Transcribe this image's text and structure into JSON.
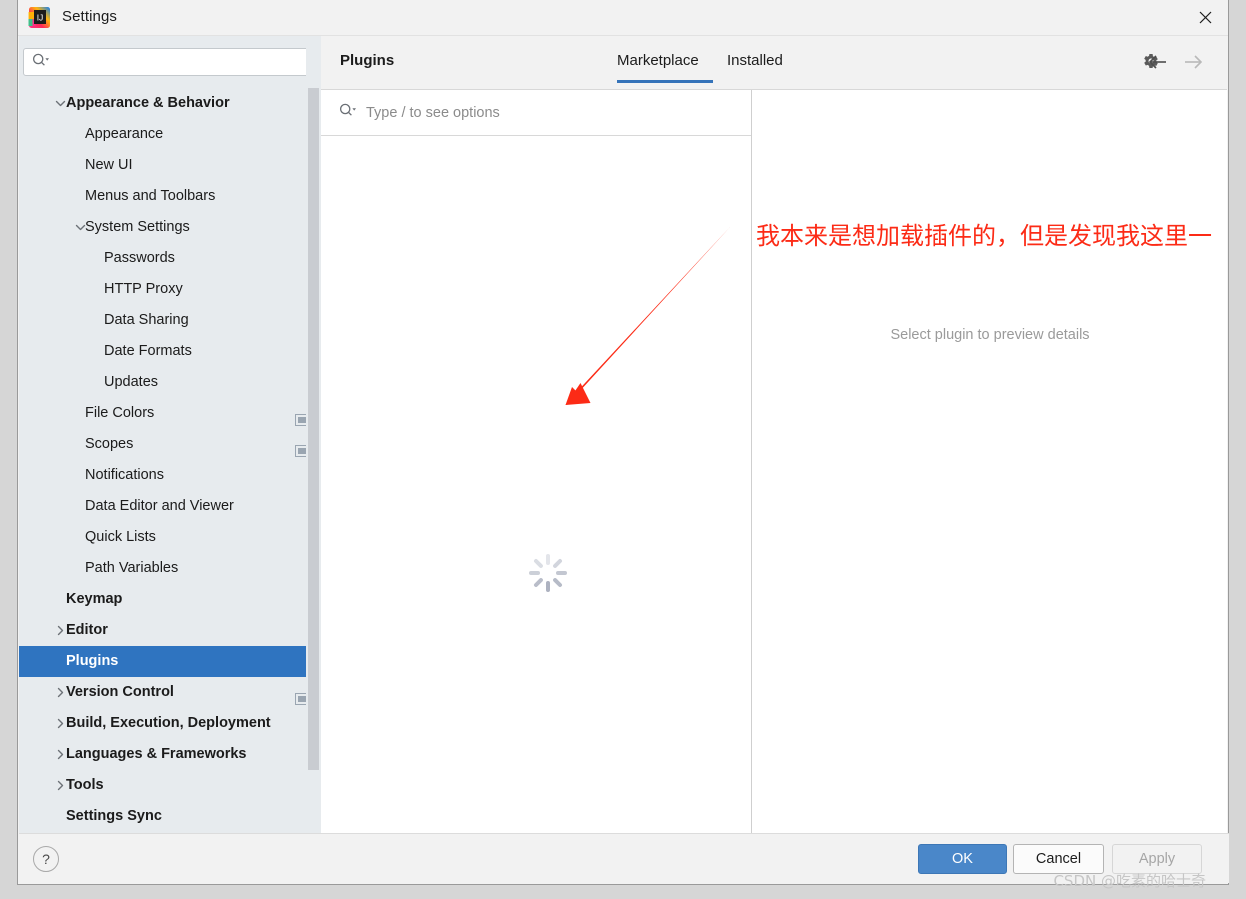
{
  "window": {
    "title": "Settings",
    "app_icon": "intellij-idea-logo",
    "close_icon": "close-icon"
  },
  "sidebar": {
    "search": {
      "placeholder": "",
      "value": "",
      "icon": "search-icon"
    },
    "items": [
      {
        "label": "Appearance & Behavior",
        "level": 0,
        "bold": true,
        "chevron": "down",
        "selected": false,
        "badge": false
      },
      {
        "label": "Appearance",
        "level": 1,
        "bold": false,
        "chevron": "none",
        "selected": false,
        "badge": false
      },
      {
        "label": "New UI",
        "level": 1,
        "bold": false,
        "chevron": "none",
        "selected": false,
        "badge": false
      },
      {
        "label": "Menus and Toolbars",
        "level": 1,
        "bold": false,
        "chevron": "none",
        "selected": false,
        "badge": false
      },
      {
        "label": "System Settings",
        "level": 1,
        "bold": false,
        "chevron": "down",
        "selected": false,
        "badge": false
      },
      {
        "label": "Passwords",
        "level": 2,
        "bold": false,
        "chevron": "none",
        "selected": false,
        "badge": false
      },
      {
        "label": "HTTP Proxy",
        "level": 2,
        "bold": false,
        "chevron": "none",
        "selected": false,
        "badge": false
      },
      {
        "label": "Data Sharing",
        "level": 2,
        "bold": false,
        "chevron": "none",
        "selected": false,
        "badge": false
      },
      {
        "label": "Date Formats",
        "level": 2,
        "bold": false,
        "chevron": "none",
        "selected": false,
        "badge": false
      },
      {
        "label": "Updates",
        "level": 2,
        "bold": false,
        "chevron": "none",
        "selected": false,
        "badge": false
      },
      {
        "label": "File Colors",
        "level": 1,
        "bold": false,
        "chevron": "none",
        "selected": false,
        "badge": true
      },
      {
        "label": "Scopes",
        "level": 1,
        "bold": false,
        "chevron": "none",
        "selected": false,
        "badge": true
      },
      {
        "label": "Notifications",
        "level": 1,
        "bold": false,
        "chevron": "none",
        "selected": false,
        "badge": false
      },
      {
        "label": "Data Editor and Viewer",
        "level": 1,
        "bold": false,
        "chevron": "none",
        "selected": false,
        "badge": false
      },
      {
        "label": "Quick Lists",
        "level": 1,
        "bold": false,
        "chevron": "none",
        "selected": false,
        "badge": false
      },
      {
        "label": "Path Variables",
        "level": 1,
        "bold": false,
        "chevron": "none",
        "selected": false,
        "badge": false
      },
      {
        "label": "Keymap",
        "level": 0,
        "bold": true,
        "chevron": "none",
        "selected": false,
        "badge": false
      },
      {
        "label": "Editor",
        "level": 0,
        "bold": true,
        "chevron": "right",
        "selected": false,
        "badge": false
      },
      {
        "label": "Plugins",
        "level": 0,
        "bold": true,
        "chevron": "none",
        "selected": true,
        "badge": false
      },
      {
        "label": "Version Control",
        "level": 0,
        "bold": true,
        "chevron": "right",
        "selected": false,
        "badge": true
      },
      {
        "label": "Build, Execution, Deployment",
        "level": 0,
        "bold": true,
        "chevron": "right",
        "selected": false,
        "badge": false
      },
      {
        "label": "Languages & Frameworks",
        "level": 0,
        "bold": true,
        "chevron": "right",
        "selected": false,
        "badge": false
      },
      {
        "label": "Tools",
        "level": 0,
        "bold": true,
        "chevron": "right",
        "selected": false,
        "badge": false
      },
      {
        "label": "Settings Sync",
        "level": 0,
        "bold": true,
        "chevron": "none",
        "selected": false,
        "badge": false
      }
    ]
  },
  "content": {
    "page_title": "Plugins",
    "tabs": [
      {
        "label": "Marketplace",
        "active": true
      },
      {
        "label": "Installed",
        "active": false
      }
    ],
    "settings_gear": "gear-icon",
    "nav_back": "arrow-left-icon",
    "nav_forward": "arrow-right-icon",
    "plugin_search": {
      "placeholder": "Type / to see options",
      "value": "",
      "icon": "search-icon"
    },
    "loading": "loading-spinner",
    "detail_hint": "Select plugin to preview details"
  },
  "footer": {
    "help_label": "?",
    "ok_label": "OK",
    "cancel_label": "Cancel",
    "apply_label": "Apply"
  },
  "annotations": {
    "red_note": "我本来是想加载插件的，但是发现我这里一",
    "red_color": "#fc2b16",
    "arrow": "red-arrow-annotation",
    "watermark": "CSDN @吃素的哈士奇"
  }
}
